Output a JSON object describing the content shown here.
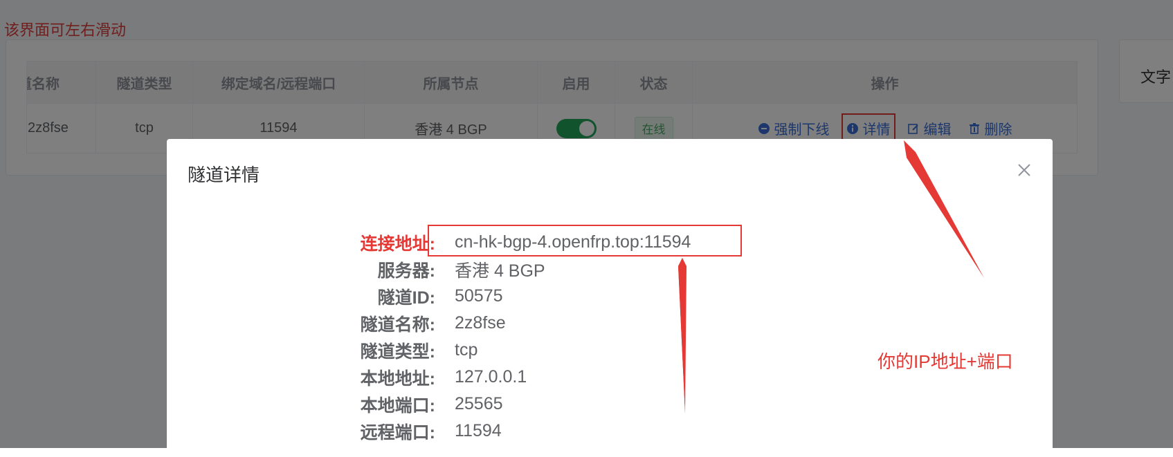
{
  "hint": "该界面可左右滑动",
  "side_card_text": "文字",
  "table": {
    "headers": [
      "隧道名称",
      "隧道类型",
      "绑定域名/远程端口",
      "所属节点",
      "启用",
      "状态",
      "操作"
    ],
    "row": {
      "name": "2z8fse",
      "type": "tcp",
      "remote": "11594",
      "node": "香港 4 BGP",
      "enabled": true,
      "status": "在线"
    },
    "actions": [
      "强制下线",
      "详情",
      "编辑",
      "删除"
    ]
  },
  "dialog": {
    "title": "隧道详情",
    "fields": [
      {
        "label": "连接地址:",
        "value": "cn-hk-bgp-4.openfrp.top:11594"
      },
      {
        "label": "服务器:",
        "value": "香港 4 BGP"
      },
      {
        "label": "隧道ID:",
        "value": "50575"
      },
      {
        "label": "隧道名称:",
        "value": "2z8fse"
      },
      {
        "label": "隧道类型:",
        "value": "tcp"
      },
      {
        "label": "本地地址:",
        "value": "127.0.0.1"
      },
      {
        "label": "本地端口:",
        "value": "25565"
      },
      {
        "label": "远程端口:",
        "value": "11594"
      }
    ]
  },
  "annotation": "你的IP地址+端口",
  "colors": {
    "accent_red": "#e53935",
    "link_blue": "#3a6fd8",
    "switch_green": "#23a65a"
  },
  "icons": [
    "minus-circle-icon",
    "info-circle-icon",
    "edit-icon",
    "trash-icon",
    "close-icon"
  ]
}
